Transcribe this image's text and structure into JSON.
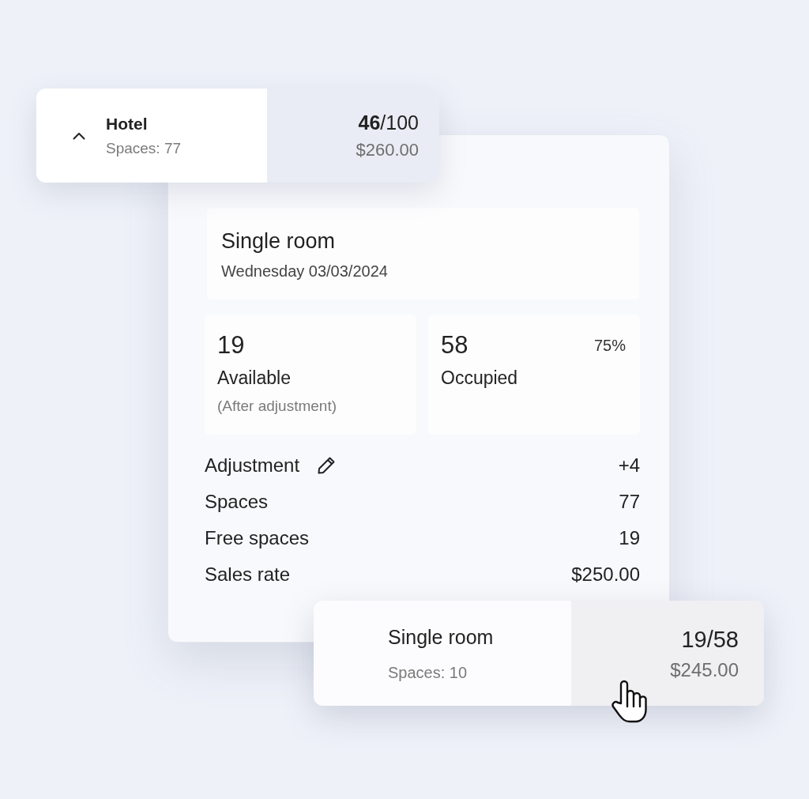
{
  "hotel_card": {
    "expanded": true,
    "title": "Hotel",
    "spaces": "Spaces: 77",
    "count": "**46**/100",
    "rate": "$260.00"
  },
  "room_panel": {
    "title": "Single room",
    "date": "Wednesday 03/03/2024",
    "stats": [
      {
        "value": "19",
        "label": "Available",
        "note": "(After adjustment)"
      },
      {
        "value": "58",
        "label": "Occupied",
        "percent": "75%"
      }
    ],
    "rows": [
      {
        "label": "Adjustment",
        "value": "+4",
        "editable": true
      },
      {
        "label": "Spaces",
        "value": "77",
        "editable": false
      },
      {
        "label": "Free spaces",
        "value": "19",
        "editable": false
      },
      {
        "label": "Sales rate",
        "value": "$250.00",
        "editable": false
      }
    ]
  },
  "room_card": {
    "title": "Single room",
    "spaces": "Spaces: 10",
    "count": "19/58",
    "rate": "$245.00"
  }
}
